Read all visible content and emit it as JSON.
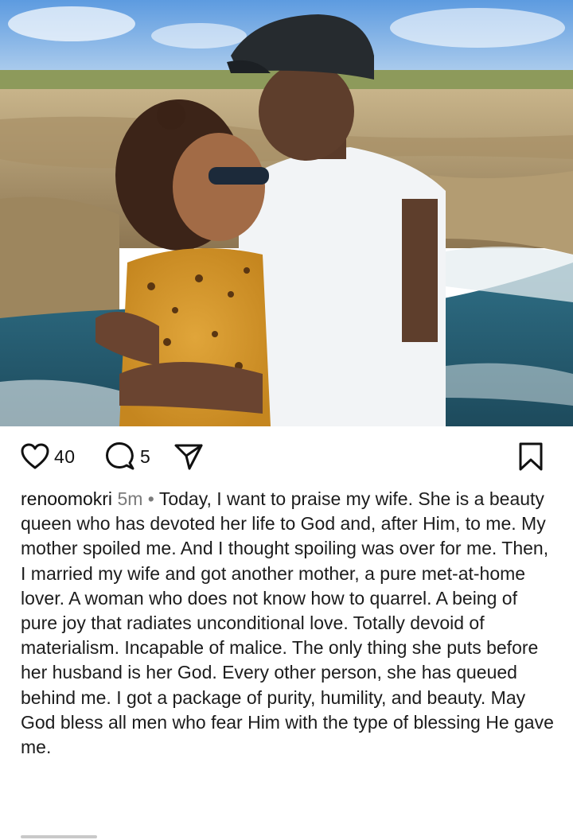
{
  "post": {
    "like_count": "40",
    "comment_count": "5",
    "username": "renoomokri",
    "timestamp": "5m",
    "separator": "•",
    "caption": "Today, I want to praise my wife. She is a beauty queen who has devoted her life to God and, after Him, to me. My mother spoiled me. And I thought spoiling was over for me. Then, I married my wife and got another mother, a pure met-at-home lover. A woman who does not know how to quarrel. A being of pure joy that radiates unconditional love. Totally devoid of materialism. Incapable of malice. The only thing she puts before her husband is her God. Every other person, she has queued behind me. I got a package of purity, humility, and beauty. May God bless all men who fear Him with the type of blessing He gave me.",
    "icons": {
      "like": "heart-icon",
      "comment": "comment-bubble-icon",
      "share": "paper-plane-icon",
      "save": "bookmark-icon"
    }
  },
  "colors": {
    "text": "#1c1c1c",
    "muted": "#7a7a7a",
    "background": "#ffffff"
  }
}
